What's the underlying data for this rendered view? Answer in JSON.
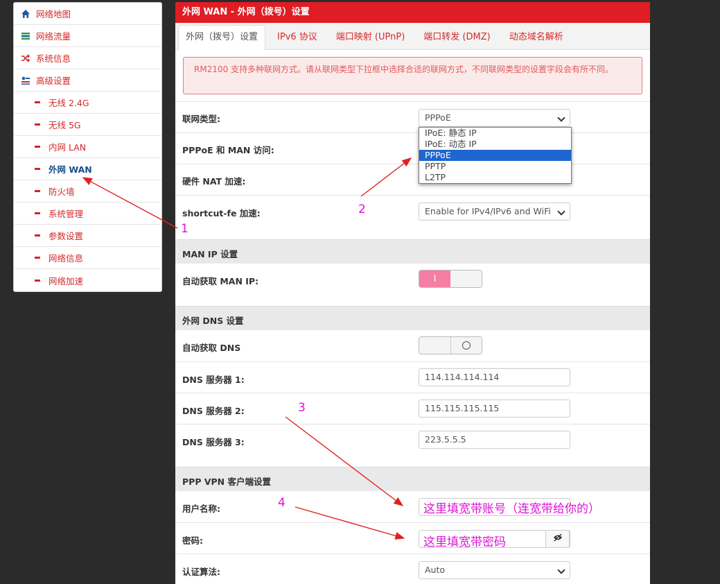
{
  "sidebar": {
    "items": [
      {
        "label": "网络地图",
        "icon": "home-icon"
      },
      {
        "label": "网络流量",
        "icon": "traffic-icon"
      },
      {
        "label": "系统信息",
        "icon": "shuffle-icon"
      },
      {
        "label": "高级设置",
        "icon": "settings-icon"
      }
    ],
    "subitems": [
      {
        "label": "无线 2.4G"
      },
      {
        "label": "无线 5G"
      },
      {
        "label": "内网 LAN"
      },
      {
        "label": "外网 WAN",
        "active": true
      },
      {
        "label": "防火墙"
      },
      {
        "label": "系统管理"
      },
      {
        "label": "参数设置"
      },
      {
        "label": "网络信息"
      },
      {
        "label": "网络加速"
      }
    ]
  },
  "panel": {
    "title": "外网 WAN - 外网（拨号）设置",
    "tabs": [
      "外网（拨号）设置",
      "IPv6 协议",
      "端口映射 (UPnP)",
      "端口转发 (DMZ)",
      "动态域名解析"
    ],
    "alert": "RM2100 支持多种联网方式。请从联网类型下拉框中选择合适的联网方式，不同联网类型的设置字段会有所不同。"
  },
  "form": {
    "wan_type_label": "联网类型:",
    "wan_type_value": "PPPoE",
    "wan_type_options": [
      "IPoE: 静态 IP",
      "IPoE: 动态 IP",
      "PPPoE",
      "PPTP",
      "L2TP"
    ],
    "pppoe_man_label": "PPPoE 和 MAN 访问:",
    "hw_nat_label": "硬件 NAT 加速:",
    "shortcut_label": "shortcut-fe 加速:",
    "shortcut_value": "Enable for IPv4/IPv6 and WiFi",
    "man_ip_section": "MAN IP 设置",
    "auto_man_ip_label": "自动获取 MAN IP:",
    "auto_man_ip_on_glyph": "I",
    "dns_section": "外网 DNS 设置",
    "auto_dns_label": "自动获取 DNS",
    "dns1_label": "DNS 服务器 1:",
    "dns1_value": "114.114.114.114",
    "dns2_label": "DNS 服务器 2:",
    "dns2_value": "115.115.115.115",
    "dns3_label": "DNS 服务器 3:",
    "dns3_value": "223.5.5.5",
    "ppp_section": "PPP VPN 客户端设置",
    "username_label": "用户名称:",
    "password_label": "密码:",
    "auth_label": "认证算法:",
    "auth_value": "Auto"
  },
  "annotations": {
    "n1": "1",
    "n2": "2",
    "n3": "3",
    "n4": "4",
    "username_hint": "这里填宽带账号（连宽带给你的）",
    "password_hint": "这里填宽带密码",
    "annotation_color": "#e012d8",
    "arrow_color": "#e02020"
  }
}
